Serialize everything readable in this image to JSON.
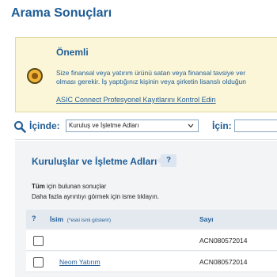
{
  "page": {
    "title": "Arama Sonuçları"
  },
  "notice": {
    "heading": "Önemli",
    "line1": "Size finansal veya yatırım ürünü satan veya finansal tavsiye ver",
    "line2": "olması gerekir. İş yaptığınız kişinin veya şirketin lisanslı olduğun",
    "link": "ASIC Connect Profesyonel Kayıtlarını Kontrol Edin",
    "icon": "warning-icon"
  },
  "search": {
    "in_label": "İçinde:",
    "selected": "Kuruluş ve İşletme Adları",
    "for_label": "İçin:",
    "query": ""
  },
  "results": {
    "heading": "Kuruluşlar ve İşletme Adları",
    "help": "?",
    "summary_bold": "Tüm",
    "summary_rest": " için bulunan sonuçlar",
    "hint": "Daha fazla ayrıntıyı görmek için isme tıklayın."
  },
  "table": {
    "help_col": "?",
    "name_col": "İsim",
    "name_col_note": "(*eski ismi gösterir)",
    "number_col": "Sayı",
    "rows": [
      {
        "name": "",
        "number": "ACN080572014"
      },
      {
        "name": "Neom Yatırım",
        "number": "ACN080572014"
      }
    ]
  },
  "colors": {
    "accent": "#1f5d96",
    "notice_bg": "#fcf6d8",
    "panel_bg": "#f2f4f6"
  }
}
